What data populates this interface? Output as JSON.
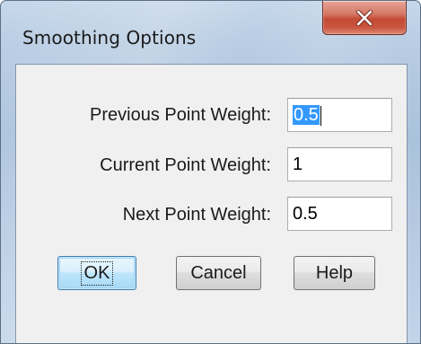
{
  "window": {
    "title": "Smoothing Options",
    "close_icon": "close-x-icon"
  },
  "fields": [
    {
      "label": "Previous Point Weight:",
      "value": "0.5",
      "selected": true
    },
    {
      "label": "Current Point Weight:",
      "value": "1",
      "selected": false
    },
    {
      "label": "Next Point Weight:",
      "value": "0.5",
      "selected": false
    }
  ],
  "buttons": {
    "ok_label": "OK",
    "cancel_label": "Cancel",
    "help_label": "Help"
  },
  "colors": {
    "close_button": "#c9553f",
    "selection_highlight": "#3399ff",
    "default_button_border": "#3c7fb1"
  }
}
